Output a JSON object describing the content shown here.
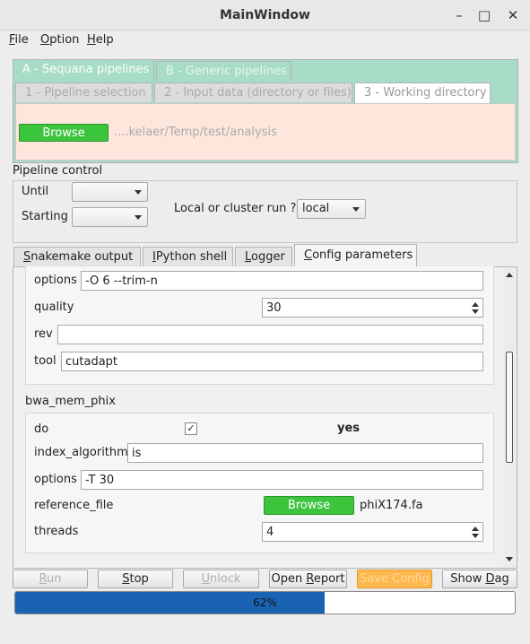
{
  "window": {
    "title": "MainWindow",
    "minimize": "–",
    "maximize": "□",
    "close": "✕"
  },
  "menu": [
    {
      "label": "File",
      "mnemonic": "F",
      "rest": "ile"
    },
    {
      "label": "Option",
      "mnemonic": "O",
      "rest": "ption"
    },
    {
      "label": "Help",
      "mnemonic": "H",
      "rest": "elp"
    }
  ],
  "pipeline_tabs": [
    "A - Sequana pipelines",
    "B - Generic pipelines"
  ],
  "step_tabs": [
    "1 - Pipeline selection",
    "2 - Input data (directory or files)",
    "3 - Working directory"
  ],
  "working_dir": {
    "browse_label": "Browse",
    "path": "....kelaer/Temp/test/analysis"
  },
  "pipeline_control": {
    "title": "Pipeline control",
    "until_label": "Until",
    "starting_label": "Starting",
    "run_mode_label": "Local or cluster run ?",
    "run_mode_value": "local"
  },
  "output_tabs": [
    {
      "pre": "",
      "mn": "S",
      "post": "nakemake output"
    },
    {
      "pre": "",
      "mn": "I",
      "post": "Python shell"
    },
    {
      "pre": "",
      "mn": "L",
      "post": "ogger"
    },
    {
      "pre": "",
      "mn": "C",
      "post": "onfig parameters"
    }
  ],
  "config": {
    "cutadapt": {
      "options_label": "options",
      "options_value": "-O 6 --trim-n",
      "quality_label": "quality",
      "quality_value": "30",
      "rev_label": "rev",
      "rev_value": "",
      "tool_label": "tool",
      "tool_value": "cutadapt"
    },
    "bwa_mem_phix": {
      "title": "bwa_mem_phix",
      "do_label": "do",
      "do_checked": "✓",
      "do_value": "yes",
      "index_label": "index_algorithm",
      "index_value": "is",
      "options_label": "options",
      "options_value": "-T 30",
      "reference_label": "reference_file",
      "reference_browse": "Browse",
      "reference_value": "phiX174.fa",
      "threads_label": "threads",
      "threads_value": "4"
    }
  },
  "actions": [
    {
      "pre": "",
      "mn": "R",
      "post": "un",
      "enabled": false
    },
    {
      "pre": "",
      "mn": "S",
      "post": "top",
      "enabled": true
    },
    {
      "pre": "",
      "mn": "U",
      "post": "nlock",
      "enabled": false
    },
    {
      "pre": "Open ",
      "mn": "R",
      "post": "eport",
      "enabled": true
    },
    {
      "pre": "Save Config",
      "mn": "",
      "post": "",
      "enabled": false
    },
    {
      "pre": "Show ",
      "mn": "D",
      "post": "ag",
      "enabled": true
    }
  ],
  "progress": {
    "percent": 62,
    "label": "62%"
  },
  "colors": {
    "accent_tab": "#a7dcc6",
    "panel_bg": "#fde6dc",
    "browse_green": "#3dc43d",
    "progress_blue": "#1a63b3",
    "save_config_orange": "#ffb84d"
  }
}
